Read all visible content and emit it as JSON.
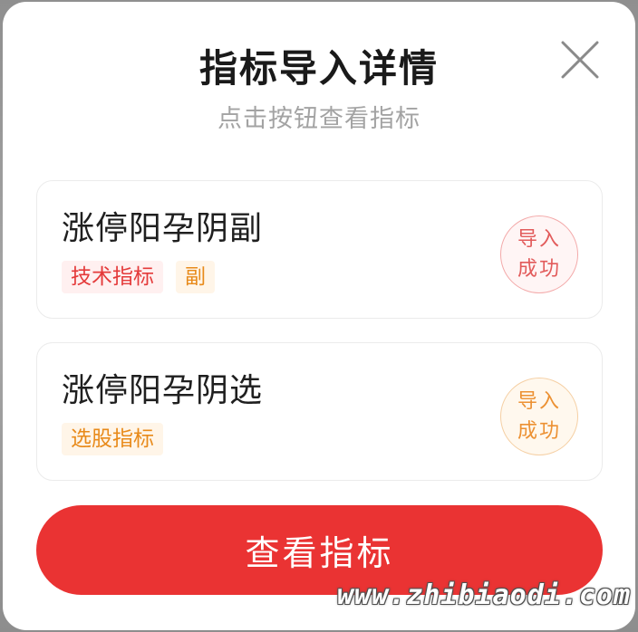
{
  "dialog": {
    "title": "指标导入详情",
    "subtitle": "点击按钮查看指标",
    "close_icon": "close-icon"
  },
  "cards": [
    {
      "name": "涨停阳孕阴副",
      "tags": [
        {
          "label": "技术指标",
          "color": "#e43a3a"
        },
        {
          "label": "副",
          "color": "#e88a1a"
        }
      ],
      "status_line1": "导入",
      "status_line2": "成功",
      "status_color": "#e25b5b"
    },
    {
      "name": "涨停阳孕阴选",
      "tags": [
        {
          "label": "选股指标",
          "color": "#e88a1a"
        }
      ],
      "status_line1": "导入",
      "status_line2": "成功",
      "status_color": "#ec9133"
    }
  ],
  "action": {
    "view_label": "查看指标",
    "color": "#ea3333"
  },
  "watermark": "www.zhibiaodi.com"
}
